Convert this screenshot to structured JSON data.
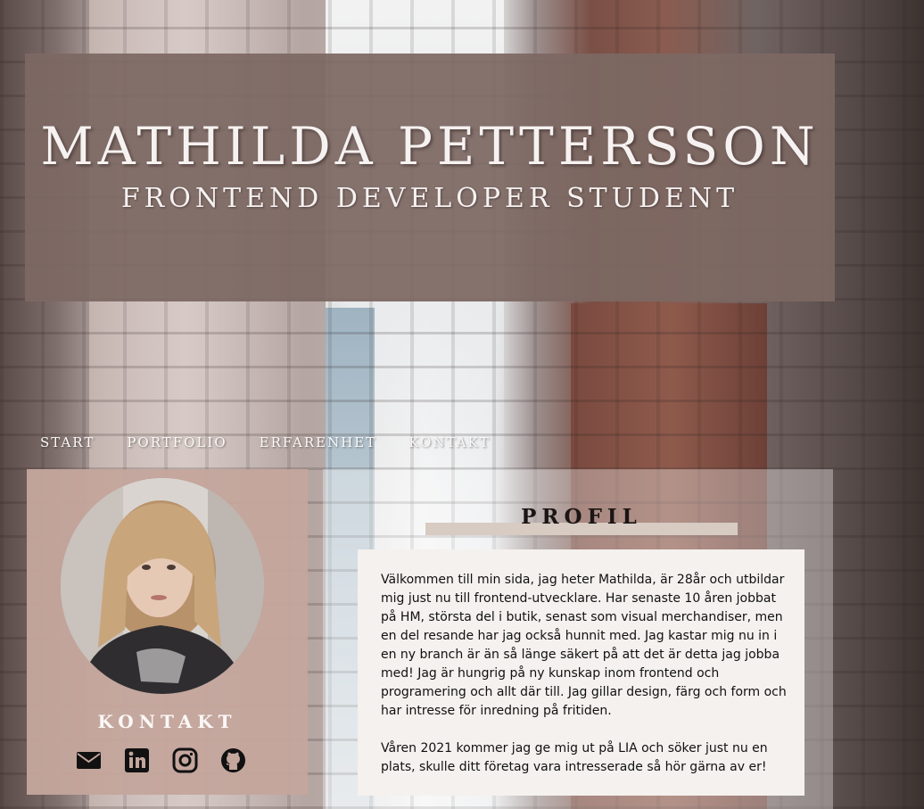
{
  "header": {
    "name": "MATHILDA PETTERSSON",
    "subtitle": "FRONTEND DEVELOPER STUDENT"
  },
  "nav": {
    "items": [
      "START",
      "PORTFOLIO",
      "ERFARENHET",
      "KONTAKT"
    ]
  },
  "contact": {
    "heading": "KONTAKT",
    "icons": [
      "email-icon",
      "linkedin-icon",
      "instagram-icon",
      "github-icon"
    ]
  },
  "profile": {
    "heading": "PROFIL",
    "paragraph_1": "Välkommen till min sida, jag heter Mathilda, är 28år och utbildar mig just nu till frontend-utvecklare. Har senaste 10 åren jobbat på HM, största del i butik, senast som visual merchandiser, men en del resande har jag också hunnit med. Jag kastar mig nu in i en ny branch är än så länge säkert på att det är detta jag jobba med! Jag är hungrig på ny kunskap inom frontend och programering och allt där till. Jag gillar design, färg och form och har intresse för inredning på fritiden.",
    "paragraph_2": "Våren 2021 kommer jag ge mig ut på LIA och söker just nu en plats, skulle ditt företag vara intresserade så hör gärna av er!"
  },
  "colors": {
    "header_bg": "#7d6863",
    "card_bg": "#c4a69c",
    "accent_bar": "#d7cbc2"
  }
}
